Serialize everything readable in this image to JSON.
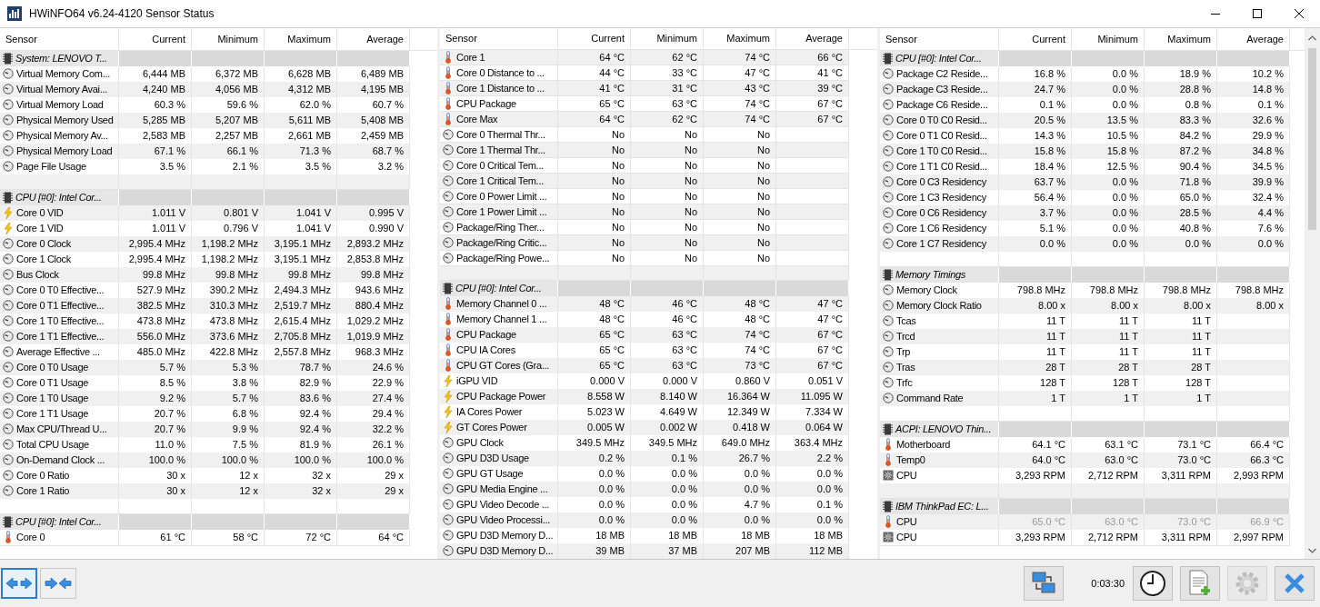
{
  "window": {
    "title": "HWiNFO64 v6.24-4120 Sensor Status"
  },
  "panels": [
    {
      "columns": [
        "Sensor",
        "Current",
        "Minimum",
        "Maximum",
        "Average"
      ],
      "groups": [
        {
          "title": "System: LENOVO T...",
          "rows": [
            {
              "kind": "clock",
              "sensor": "Virtual Memory Com...",
              "current": "6,444 MB",
              "minimum": "6,372 MB",
              "maximum": "6,628 MB",
              "average": "6,489 MB"
            },
            {
              "kind": "clock",
              "sensor": "Virtual Memory Avai...",
              "current": "4,240 MB",
              "minimum": "4,056 MB",
              "maximum": "4,312 MB",
              "average": "4,195 MB"
            },
            {
              "kind": "clock",
              "sensor": "Virtual Memory Load",
              "current": "60.3 %",
              "minimum": "59.6 %",
              "maximum": "62.0 %",
              "average": "60.7 %"
            },
            {
              "kind": "clock",
              "sensor": "Physical Memory Used",
              "current": "5,285 MB",
              "minimum": "5,207 MB",
              "maximum": "5,611 MB",
              "average": "5,408 MB"
            },
            {
              "kind": "clock",
              "sensor": "Physical Memory Av...",
              "current": "2,583 MB",
              "minimum": "2,257 MB",
              "maximum": "2,661 MB",
              "average": "2,459 MB"
            },
            {
              "kind": "clock",
              "sensor": "Physical Memory Load",
              "current": "67.1 %",
              "minimum": "66.1 %",
              "maximum": "71.3 %",
              "average": "68.7 %"
            },
            {
              "kind": "clock",
              "sensor": "Page File Usage",
              "current": "3.5 %",
              "minimum": "2.1 %",
              "maximum": "3.5 %",
              "average": "3.2 %"
            }
          ]
        },
        {
          "title": "CPU [#0]: Intel Cor...",
          "rows": [
            {
              "kind": "volt",
              "sensor": "Core 0 VID",
              "current": "1.011 V",
              "minimum": "0.801 V",
              "maximum": "1.041 V",
              "average": "0.995 V"
            },
            {
              "kind": "volt",
              "sensor": "Core 1 VID",
              "current": "1.011 V",
              "minimum": "0.796 V",
              "maximum": "1.041 V",
              "average": "0.990 V"
            },
            {
              "kind": "clock",
              "sensor": "Core 0 Clock",
              "current": "2,995.4 MHz",
              "minimum": "1,198.2 MHz",
              "maximum": "3,195.1 MHz",
              "average": "2,893.2 MHz"
            },
            {
              "kind": "clock",
              "sensor": "Core 1 Clock",
              "current": "2,995.4 MHz",
              "minimum": "1,198.2 MHz",
              "maximum": "3,195.1 MHz",
              "average": "2,853.8 MHz"
            },
            {
              "kind": "clock",
              "sensor": "Bus Clock",
              "current": "99.8 MHz",
              "minimum": "99.8 MHz",
              "maximum": "99.8 MHz",
              "average": "99.8 MHz"
            },
            {
              "kind": "clock",
              "sensor": "Core 0 T0 Effective...",
              "current": "527.9 MHz",
              "minimum": "390.2 MHz",
              "maximum": "2,494.3 MHz",
              "average": "943.6 MHz"
            },
            {
              "kind": "clock",
              "sensor": "Core 0 T1 Effective...",
              "current": "382.5 MHz",
              "minimum": "310.3 MHz",
              "maximum": "2,519.7 MHz",
              "average": "880.4 MHz"
            },
            {
              "kind": "clock",
              "sensor": "Core 1 T0 Effective...",
              "current": "473.8 MHz",
              "minimum": "473.8 MHz",
              "maximum": "2,615.4 MHz",
              "average": "1,029.2 MHz"
            },
            {
              "kind": "clock",
              "sensor": "Core 1 T1 Effective...",
              "current": "556.0 MHz",
              "minimum": "373.6 MHz",
              "maximum": "2,705.8 MHz",
              "average": "1,019.9 MHz"
            },
            {
              "kind": "clock",
              "sensor": "Average Effective ...",
              "current": "485.0 MHz",
              "minimum": "422.8 MHz",
              "maximum": "2,557.8 MHz",
              "average": "968.3 MHz"
            },
            {
              "kind": "clock",
              "sensor": "Core 0 T0 Usage",
              "current": "5.7 %",
              "minimum": "5.3 %",
              "maximum": "78.7 %",
              "average": "24.6 %"
            },
            {
              "kind": "clock",
              "sensor": "Core 0 T1 Usage",
              "current": "8.5 %",
              "minimum": "3.8 %",
              "maximum": "82.9 %",
              "average": "22.9 %"
            },
            {
              "kind": "clock",
              "sensor": "Core 1 T0 Usage",
              "current": "9.2 %",
              "minimum": "5.7 %",
              "maximum": "83.6 %",
              "average": "27.4 %"
            },
            {
              "kind": "clock",
              "sensor": "Core 1 T1 Usage",
              "current": "20.7 %",
              "minimum": "6.8 %",
              "maximum": "92.4 %",
              "average": "29.4 %"
            },
            {
              "kind": "clock",
              "sensor": "Max CPU/Thread U...",
              "current": "20.7 %",
              "minimum": "9.9 %",
              "maximum": "92.4 %",
              "average": "32.2 %"
            },
            {
              "kind": "clock",
              "sensor": "Total CPU Usage",
              "current": "11.0 %",
              "minimum": "7.5 %",
              "maximum": "81.9 %",
              "average": "26.1 %"
            },
            {
              "kind": "clock",
              "sensor": "On-Demand Clock ...",
              "current": "100.0 %",
              "minimum": "100.0 %",
              "maximum": "100.0 %",
              "average": "100.0 %"
            },
            {
              "kind": "clock",
              "sensor": "Core 0 Ratio",
              "current": "30 x",
              "minimum": "12 x",
              "maximum": "32 x",
              "average": "29 x"
            },
            {
              "kind": "clock",
              "sensor": "Core 1 Ratio",
              "current": "30 x",
              "minimum": "12 x",
              "maximum": "32 x",
              "average": "29 x"
            }
          ]
        },
        {
          "title": "CPU [#0]: Intel Cor...",
          "rows": [
            {
              "kind": "temp",
              "sensor": "Core 0",
              "current": "61 °C",
              "minimum": "58 °C",
              "maximum": "72 °C",
              "average": "64 °C"
            }
          ]
        }
      ]
    },
    {
      "columns": [
        "Sensor",
        "Current",
        "Minimum",
        "Maximum",
        "Average"
      ],
      "groups": [
        {
          "rows": [
            {
              "kind": "temp",
              "sensor": "Core 1",
              "current": "64 °C",
              "minimum": "62 °C",
              "maximum": "74 °C",
              "average": "66 °C"
            },
            {
              "kind": "temp",
              "sensor": "Core 0 Distance to ...",
              "current": "44 °C",
              "minimum": "33 °C",
              "maximum": "47 °C",
              "average": "41 °C"
            },
            {
              "kind": "temp",
              "sensor": "Core 1 Distance to ...",
              "current": "41 °C",
              "minimum": "31 °C",
              "maximum": "43 °C",
              "average": "39 °C"
            },
            {
              "kind": "temp",
              "sensor": "CPU Package",
              "current": "65 °C",
              "minimum": "63 °C",
              "maximum": "74 °C",
              "average": "67 °C"
            },
            {
              "kind": "temp",
              "sensor": "Core Max",
              "current": "64 °C",
              "minimum": "62 °C",
              "maximum": "74 °C",
              "average": "67 °C"
            },
            {
              "kind": "clock",
              "sensor": "Core 0 Thermal Thr...",
              "current": "No",
              "minimum": "No",
              "maximum": "No"
            },
            {
              "kind": "clock",
              "sensor": "Core 1 Thermal Thr...",
              "current": "No",
              "minimum": "No",
              "maximum": "No"
            },
            {
              "kind": "clock",
              "sensor": "Core 0 Critical Tem...",
              "current": "No",
              "minimum": "No",
              "maximum": "No"
            },
            {
              "kind": "clock",
              "sensor": "Core 1 Critical Tem...",
              "current": "No",
              "minimum": "No",
              "maximum": "No"
            },
            {
              "kind": "clock",
              "sensor": "Core 0 Power Limit ...",
              "current": "No",
              "minimum": "No",
              "maximum": "No"
            },
            {
              "kind": "clock",
              "sensor": "Core 1 Power Limit ...",
              "current": "No",
              "minimum": "No",
              "maximum": "No"
            },
            {
              "kind": "clock",
              "sensor": "Package/Ring Ther...",
              "current": "No",
              "minimum": "No",
              "maximum": "No"
            },
            {
              "kind": "clock",
              "sensor": "Package/Ring Critic...",
              "current": "No",
              "minimum": "No",
              "maximum": "No"
            },
            {
              "kind": "clock",
              "sensor": "Package/Ring Powe...",
              "current": "No",
              "minimum": "No",
              "maximum": "No"
            }
          ]
        },
        {
          "title": "CPU [#0]: Intel Cor...",
          "rows": [
            {
              "kind": "temp",
              "sensor": "Memory Channel 0 ...",
              "current": "48 °C",
              "minimum": "46 °C",
              "maximum": "48 °C",
              "average": "47 °C"
            },
            {
              "kind": "temp",
              "sensor": "Memory Channel 1 ...",
              "current": "48 °C",
              "minimum": "46 °C",
              "maximum": "48 °C",
              "average": "47 °C"
            },
            {
              "kind": "temp",
              "sensor": "CPU Package",
              "current": "65 °C",
              "minimum": "63 °C",
              "maximum": "74 °C",
              "average": "67 °C"
            },
            {
              "kind": "temp",
              "sensor": "CPU IA Cores",
              "current": "65 °C",
              "minimum": "63 °C",
              "maximum": "74 °C",
              "average": "67 °C"
            },
            {
              "kind": "temp",
              "sensor": "CPU GT Cores (Gra...",
              "current": "65 °C",
              "minimum": "63 °C",
              "maximum": "73 °C",
              "average": "67 °C"
            },
            {
              "kind": "volt",
              "sensor": "iGPU VID",
              "current": "0.000 V",
              "minimum": "0.000 V",
              "maximum": "0.860 V",
              "average": "0.051 V"
            },
            {
              "kind": "volt",
              "sensor": "CPU Package Power",
              "current": "8.558 W",
              "minimum": "8.140 W",
              "maximum": "16.364 W",
              "average": "11.095 W"
            },
            {
              "kind": "volt",
              "sensor": "IA Cores Power",
              "current": "5.023 W",
              "minimum": "4.649 W",
              "maximum": "12.349 W",
              "average": "7.334 W"
            },
            {
              "kind": "volt",
              "sensor": "GT Cores Power",
              "current": "0.005 W",
              "minimum": "0.002 W",
              "maximum": "0.418 W",
              "average": "0.064 W"
            },
            {
              "kind": "clock",
              "sensor": "GPU Clock",
              "current": "349.5 MHz",
              "minimum": "349.5 MHz",
              "maximum": "649.0 MHz",
              "average": "363.4 MHz"
            },
            {
              "kind": "clock",
              "sensor": "GPU D3D Usage",
              "current": "0.2 %",
              "minimum": "0.1 %",
              "maximum": "26.7 %",
              "average": "2.2 %"
            },
            {
              "kind": "clock",
              "sensor": "GPU GT Usage",
              "current": "0.0 %",
              "minimum": "0.0 %",
              "maximum": "0.0 %",
              "average": "0.0 %"
            },
            {
              "kind": "clock",
              "sensor": "GPU Media Engine ...",
              "current": "0.0 %",
              "minimum": "0.0 %",
              "maximum": "0.0 %",
              "average": "0.0 %"
            },
            {
              "kind": "clock",
              "sensor": "GPU Video Decode ...",
              "current": "0.0 %",
              "minimum": "0.0 %",
              "maximum": "4.7 %",
              "average": "0.1 %"
            },
            {
              "kind": "clock",
              "sensor": "GPU Video Processi...",
              "current": "0.0 %",
              "minimum": "0.0 %",
              "maximum": "0.0 %",
              "average": "0.0 %"
            },
            {
              "kind": "clock",
              "sensor": "GPU D3D Memory D...",
              "current": "18 MB",
              "minimum": "18 MB",
              "maximum": "18 MB",
              "average": "18 MB"
            },
            {
              "kind": "clock",
              "sensor": "GPU D3D Memory D...",
              "current": "39 MB",
              "minimum": "37 MB",
              "maximum": "207 MB",
              "average": "112 MB"
            }
          ]
        }
      ]
    },
    {
      "columns": [
        "Sensor",
        "Current",
        "Minimum",
        "Maximum",
        "Average"
      ],
      "groups": [
        {
          "title": "CPU [#0]: Intel Cor...",
          "rows": [
            {
              "kind": "clock",
              "sensor": "Package C2 Reside...",
              "current": "16.8 %",
              "minimum": "0.0 %",
              "maximum": "18.9 %",
              "average": "10.2 %"
            },
            {
              "kind": "clock",
              "sensor": "Package C3 Reside...",
              "current": "24.7 %",
              "minimum": "0.0 %",
              "maximum": "28.8 %",
              "average": "14.8 %"
            },
            {
              "kind": "clock",
              "sensor": "Package C6 Reside...",
              "current": "0.1 %",
              "minimum": "0.0 %",
              "maximum": "0.8 %",
              "average": "0.1 %"
            },
            {
              "kind": "clock",
              "sensor": "Core 0 T0 C0 Resid...",
              "current": "20.5 %",
              "minimum": "13.5 %",
              "maximum": "83.3 %",
              "average": "32.6 %"
            },
            {
              "kind": "clock",
              "sensor": "Core 0 T1 C0 Resid...",
              "current": "14.3 %",
              "minimum": "10.5 %",
              "maximum": "84.2 %",
              "average": "29.9 %"
            },
            {
              "kind": "clock",
              "sensor": "Core 1 T0 C0 Resid...",
              "current": "15.8 %",
              "minimum": "15.8 %",
              "maximum": "87.2 %",
              "average": "34.8 %"
            },
            {
              "kind": "clock",
              "sensor": "Core 1 T1 C0 Resid...",
              "current": "18.4 %",
              "minimum": "12.5 %",
              "maximum": "90.4 %",
              "average": "34.5 %"
            },
            {
              "kind": "clock",
              "sensor": "Core 0 C3 Residency",
              "current": "63.7 %",
              "minimum": "0.0 %",
              "maximum": "71.8 %",
              "average": "39.9 %"
            },
            {
              "kind": "clock",
              "sensor": "Core 1 C3 Residency",
              "current": "56.4 %",
              "minimum": "0.0 %",
              "maximum": "65.0 %",
              "average": "32.4 %"
            },
            {
              "kind": "clock",
              "sensor": "Core 0 C6 Residency",
              "current": "3.7 %",
              "minimum": "0.0 %",
              "maximum": "28.5 %",
              "average": "4.4 %"
            },
            {
              "kind": "clock",
              "sensor": "Core 1 C6 Residency",
              "current": "5.1 %",
              "minimum": "0.0 %",
              "maximum": "40.8 %",
              "average": "7.6 %"
            },
            {
              "kind": "clock",
              "sensor": "Core 1 C7 Residency",
              "current": "0.0 %",
              "minimum": "0.0 %",
              "maximum": "0.0 %",
              "average": "0.0 %"
            }
          ]
        },
        {
          "title": "Memory Timings",
          "rows": [
            {
              "kind": "clock",
              "sensor": "Memory Clock",
              "current": "798.8 MHz",
              "minimum": "798.8 MHz",
              "maximum": "798.8 MHz",
              "average": "798.8 MHz"
            },
            {
              "kind": "clock",
              "sensor": "Memory Clock Ratio",
              "current": "8.00 x",
              "minimum": "8.00 x",
              "maximum": "8.00 x",
              "average": "8.00 x"
            },
            {
              "kind": "clock",
              "sensor": "Tcas",
              "current": "11 T",
              "minimum": "11 T",
              "maximum": "11 T"
            },
            {
              "kind": "clock",
              "sensor": "Trcd",
              "current": "11 T",
              "minimum": "11 T",
              "maximum": "11 T"
            },
            {
              "kind": "clock",
              "sensor": "Trp",
              "current": "11 T",
              "minimum": "11 T",
              "maximum": "11 T"
            },
            {
              "kind": "clock",
              "sensor": "Tras",
              "current": "28 T",
              "minimum": "28 T",
              "maximum": "28 T"
            },
            {
              "kind": "clock",
              "sensor": "Trfc",
              "current": "128 T",
              "minimum": "128 T",
              "maximum": "128 T"
            },
            {
              "kind": "clock",
              "sensor": "Command Rate",
              "current": "1 T",
              "minimum": "1 T",
              "maximum": "1 T"
            }
          ]
        },
        {
          "title": "ACPI: LENOVO Thin...",
          "rows": [
            {
              "kind": "temp",
              "sensor": "Motherboard",
              "current": "64.1 °C",
              "minimum": "63.1 °C",
              "maximum": "73.1 °C",
              "average": "66.4 °C"
            },
            {
              "kind": "temp",
              "sensor": "Temp0",
              "current": "64.0 °C",
              "minimum": "63.0 °C",
              "maximum": "73.0 °C",
              "average": "66.3 °C"
            },
            {
              "kind": "fan",
              "sensor": "CPU",
              "current": "3,293 RPM",
              "minimum": "2,712 RPM",
              "maximum": "3,311 RPM",
              "average": "2,993 RPM"
            }
          ]
        },
        {
          "title": "IBM ThinkPad EC: L...",
          "rows": [
            {
              "kind": "temp",
              "dimmed": true,
              "sensor": "CPU",
              "current": "65.0 °C",
              "minimum": "63.0 °C",
              "maximum": "73.0 °C",
              "average": "66.9 °C"
            },
            {
              "kind": "fan",
              "dimmed": false,
              "sensor": "CPU",
              "current": "3,293 RPM",
              "minimum": "2,712 RPM",
              "maximum": "3,311 RPM",
              "average": "2,997 RPM"
            }
          ]
        }
      ]
    }
  ],
  "toolbar": {
    "left_buttons": [
      {
        "kind": "expand",
        "selected": true
      },
      {
        "kind": "collapse",
        "selected": false
      }
    ],
    "elapsed": "0:03:30",
    "right_buttons": [
      {
        "kind": "network",
        "disabled": false
      },
      {
        "kind": "clock",
        "disabled": false
      },
      {
        "kind": "report",
        "disabled": false
      },
      {
        "kind": "settings",
        "disabled": true
      },
      {
        "kind": "close",
        "disabled": false
      }
    ]
  }
}
